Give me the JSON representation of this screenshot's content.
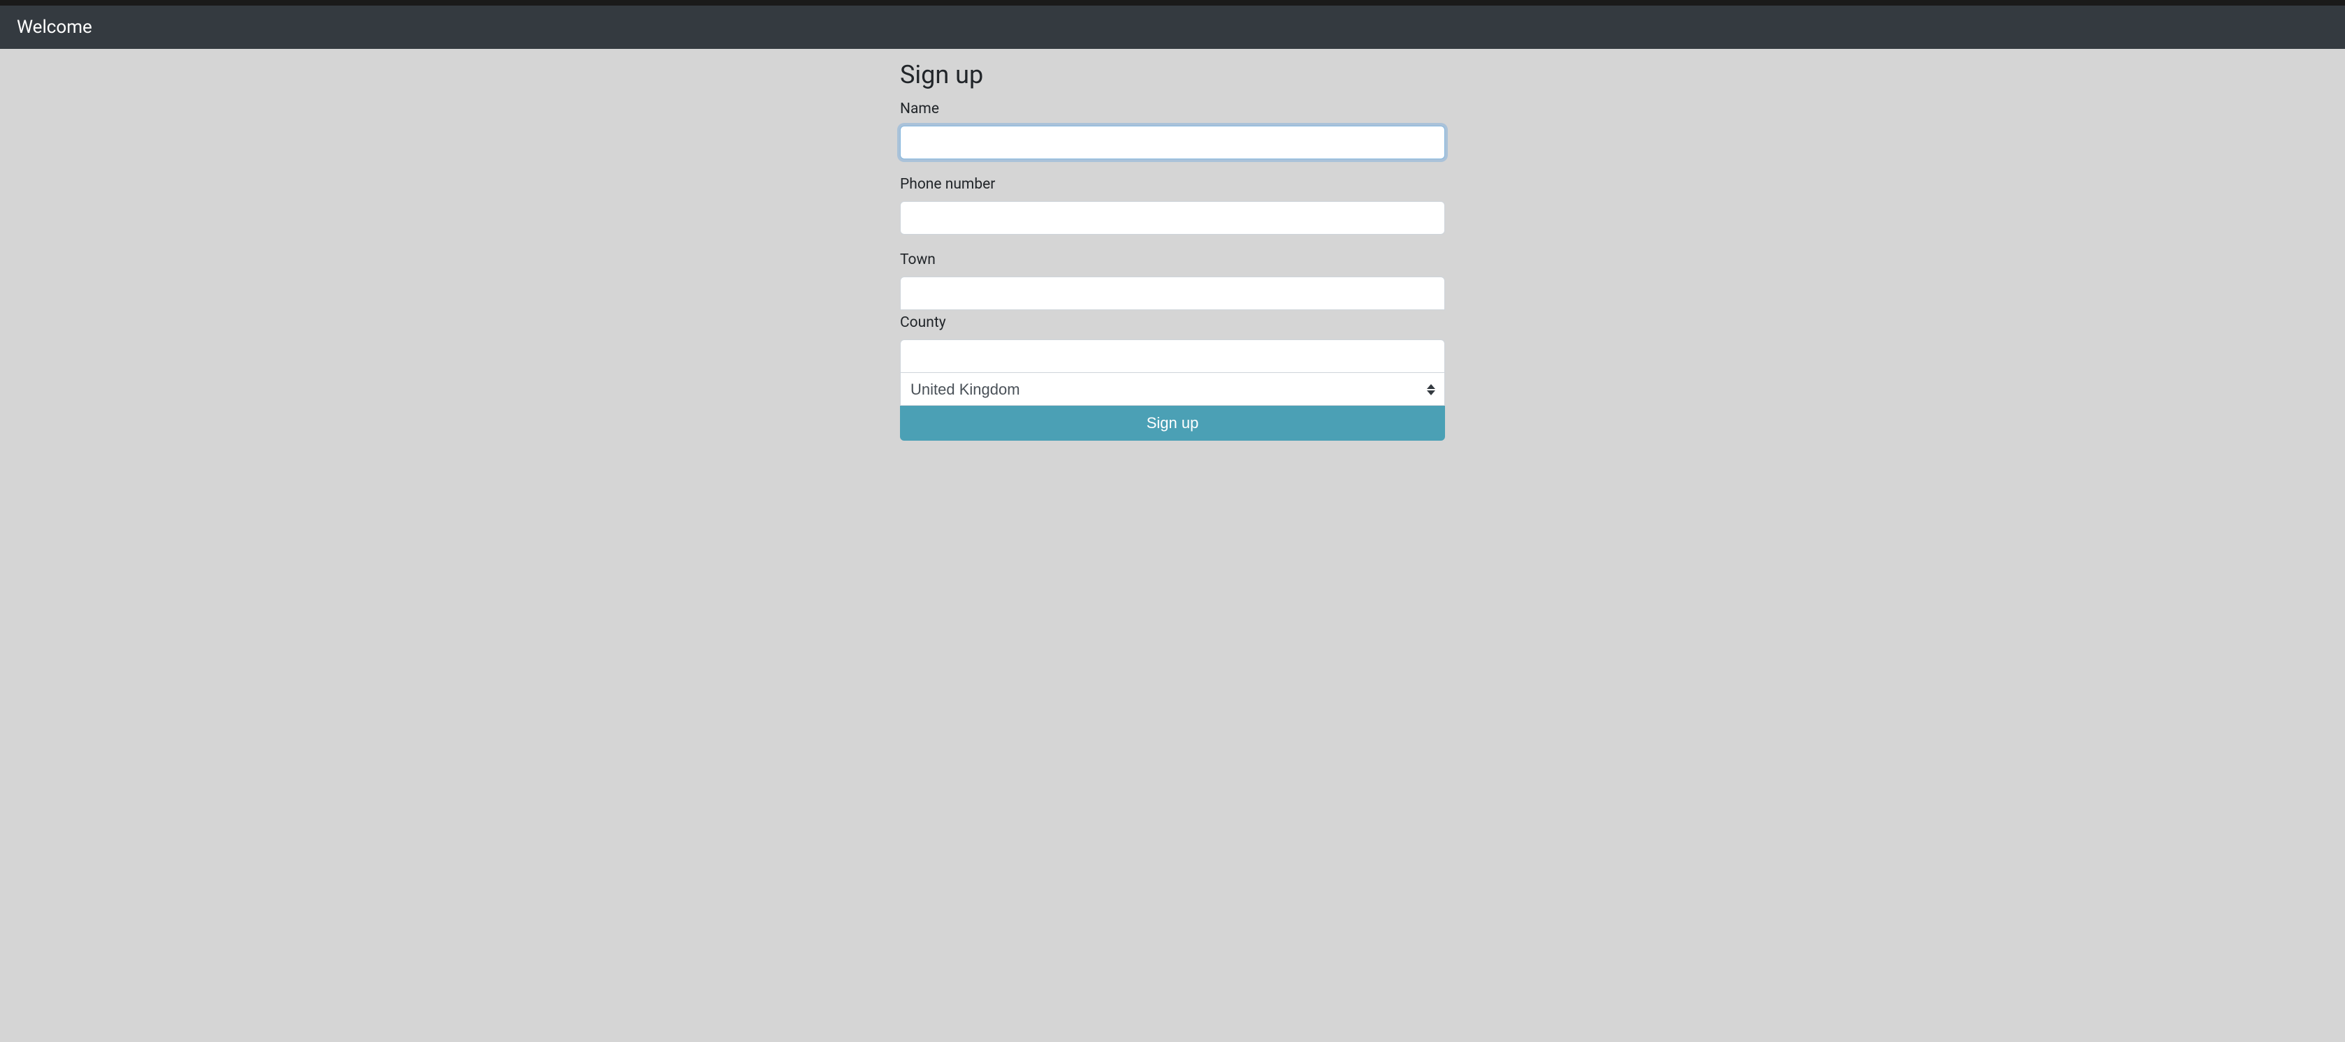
{
  "navbar": {
    "brand": "Welcome"
  },
  "form": {
    "title": "Sign up",
    "fields": {
      "name": {
        "label": "Name",
        "value": ""
      },
      "phone": {
        "label": "Phone number",
        "value": ""
      },
      "town": {
        "label": "Town",
        "value": ""
      },
      "county": {
        "label": "County",
        "value": ""
      },
      "country": {
        "selected": "United Kingdom"
      }
    },
    "submit_label": "Sign up"
  }
}
